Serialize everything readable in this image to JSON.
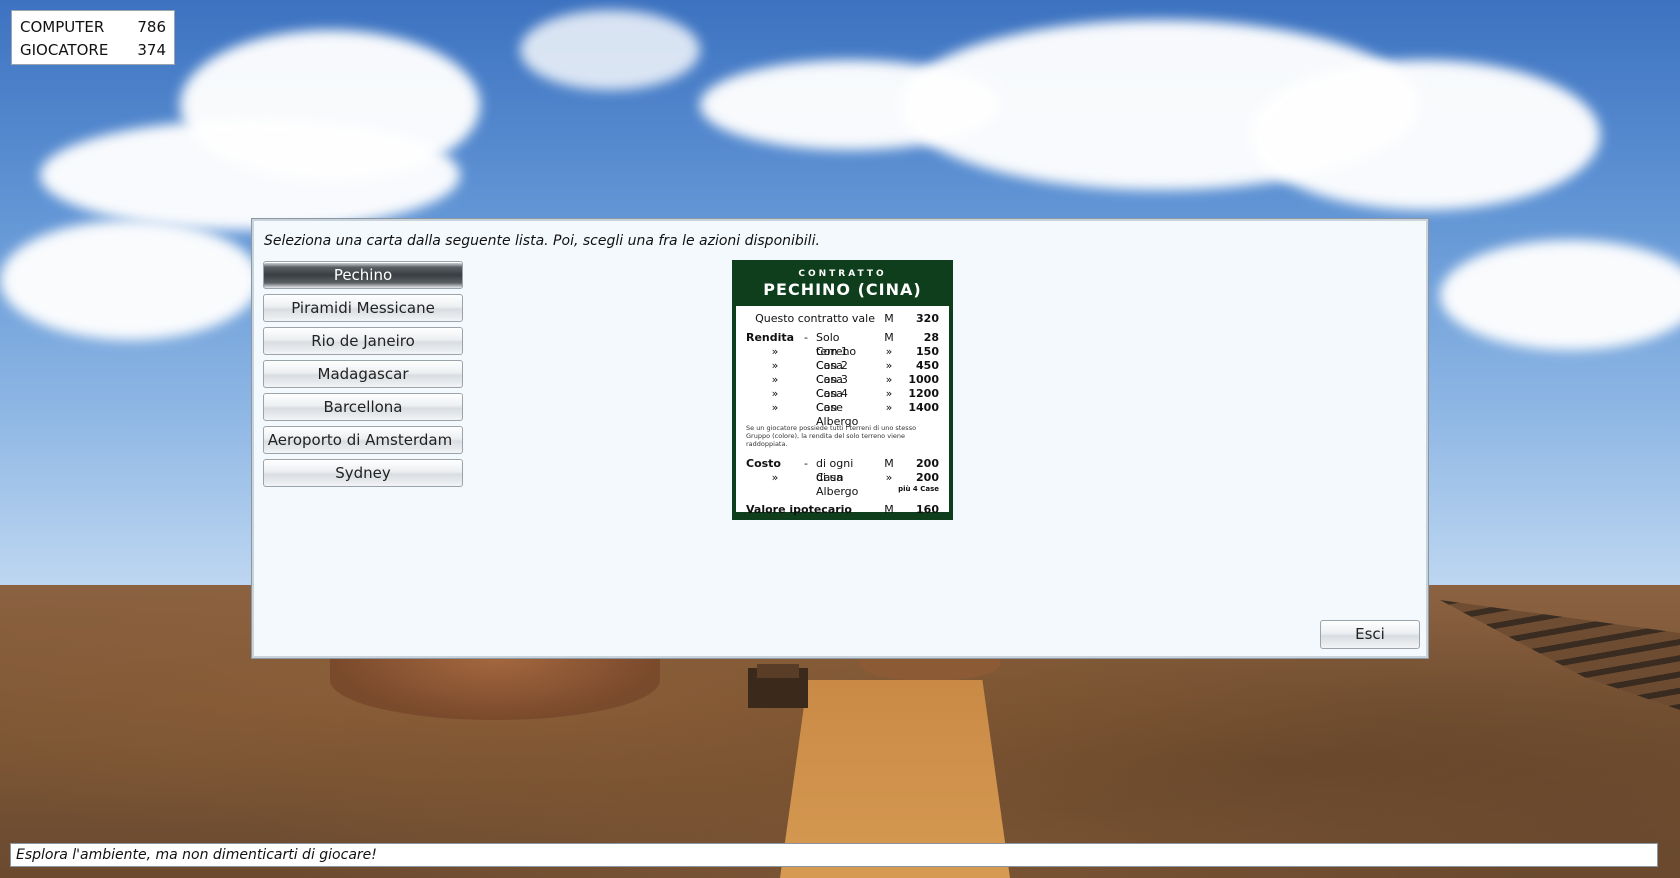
{
  "score": {
    "rows": [
      {
        "name": "COMPUTER",
        "value": "786"
      },
      {
        "name": "GIOCATORE",
        "value": "374"
      }
    ]
  },
  "dialog": {
    "instructions": "Seleziona una carta dalla seguente lista. Poi, scegli una fra le azioni disponibili.",
    "cards": [
      {
        "label": "Pechino",
        "selected": true
      },
      {
        "label": "Piramidi Messicane"
      },
      {
        "label": "Rio de Janeiro"
      },
      {
        "label": "Madagascar"
      },
      {
        "label": "Barcellona"
      },
      {
        "label": "Aeroporto di Amsterdam"
      },
      {
        "label": "Sydney"
      }
    ],
    "exit_label": "Esci"
  },
  "contract": {
    "kicker": "CONTRATTO",
    "title": "PECHINO (CINA)",
    "value_line": {
      "label": "Questo contratto vale",
      "currency": "M",
      "value": "320"
    },
    "rent_label": "Rendita",
    "rent_rows": [
      {
        "prefix": "-",
        "desc": "Solo terreno",
        "currency": "M",
        "value": "28"
      },
      {
        "prefix": "»",
        "desc": "Con 1 Casa",
        "currency": "»",
        "value": "150"
      },
      {
        "prefix": "»",
        "desc": "Con 2 Casa",
        "currency": "»",
        "value": "450"
      },
      {
        "prefix": "»",
        "desc": "Con 3 Casa",
        "currency": "»",
        "value": "1000"
      },
      {
        "prefix": "»",
        "desc": "Con 4 Case",
        "currency": "»",
        "value": "1200"
      },
      {
        "prefix": "»",
        "desc": "Con Albergo",
        "currency": "»",
        "value": "1400"
      }
    ],
    "note": "Se un giocatore possiede tutti i terreni di uno stesso Gruppo (colore), la rendita del solo terreno viene raddoppiata.",
    "cost_label": "Costo",
    "cost_rows": [
      {
        "prefix": "-",
        "desc": "di ogni Casa",
        "currency": "M",
        "value": "200"
      },
      {
        "prefix": "»",
        "desc": "di un Albergo",
        "currency": "»",
        "value": "200"
      }
    ],
    "cost_subnote": "più 4 Case",
    "mortgage": {
      "label": "Valore ipotecario",
      "currency": "M",
      "value": "160"
    }
  },
  "status_text": "Esplora l'ambiente, ma non dimenticarti di giocare!"
}
